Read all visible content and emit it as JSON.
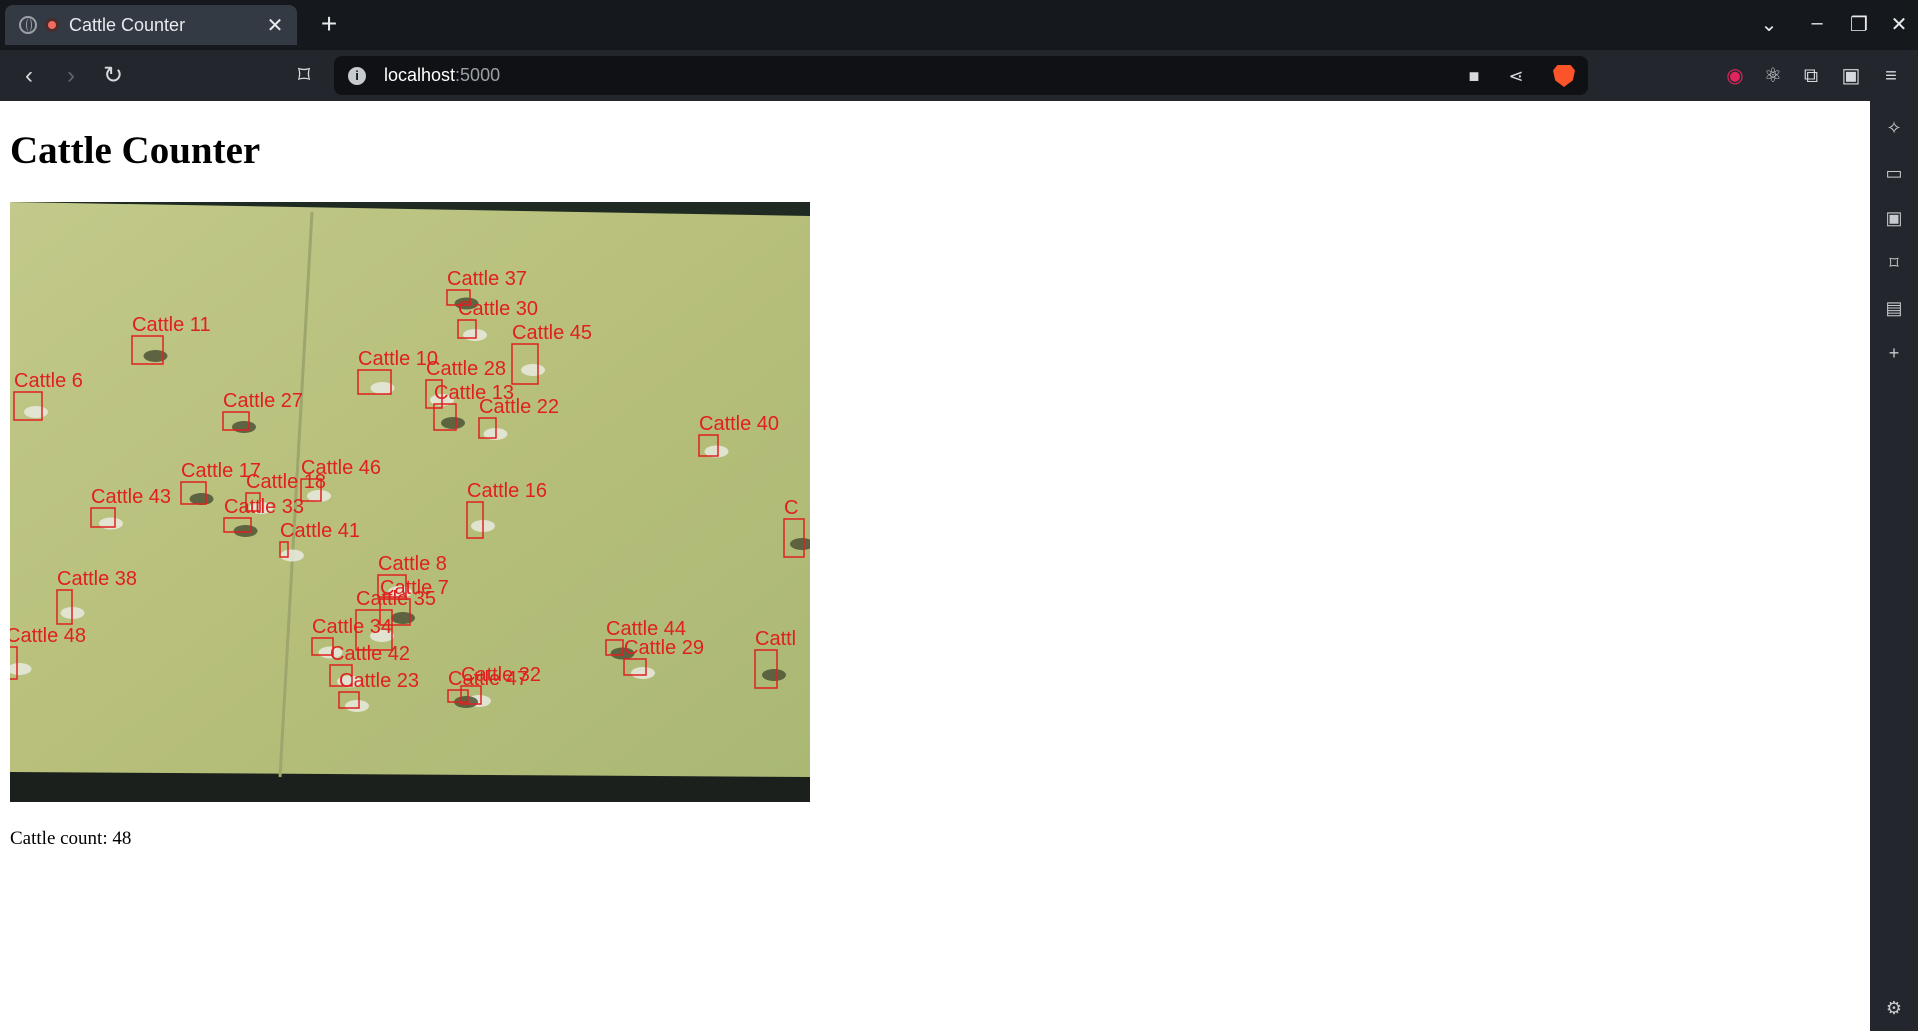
{
  "browser": {
    "tab_title": "Cattle Counter",
    "url_host": "localhost",
    "url_port": ":5000"
  },
  "page": {
    "heading": "Cattle Counter",
    "count_label": "Cattle count: ",
    "count_value": "48"
  },
  "detections": [
    {
      "label": "Cattle 37"
    },
    {
      "label": "Cattle 30"
    },
    {
      "label": "Cattle 45"
    },
    {
      "label": "Cattle 11"
    },
    {
      "label": "Cattle 10"
    },
    {
      "label": "Cattle 28"
    },
    {
      "label": "Cattle 13"
    },
    {
      "label": "Cattle 22"
    },
    {
      "label": "Cattle 6"
    },
    {
      "label": "Cattle 27"
    },
    {
      "label": "Cattle 40"
    },
    {
      "label": "Cattle 46"
    },
    {
      "label": "Cattle 17"
    },
    {
      "label": "Cattle 18"
    },
    {
      "label": "Cattle 43"
    },
    {
      "label": "Cattle 33"
    },
    {
      "label": "Cattle 16"
    },
    {
      "label": "Cattle 41"
    },
    {
      "label": "C"
    },
    {
      "label": "Cattle 8"
    },
    {
      "label": "Cattle 38"
    },
    {
      "label": "Cattle 7"
    },
    {
      "label": "Cattle 35"
    },
    {
      "label": "Cattle 34"
    },
    {
      "label": "Cattle 44"
    },
    {
      "label": "Cattle 48"
    },
    {
      "label": "Cattle 29"
    },
    {
      "label": "Cattl"
    },
    {
      "label": "Cattle 42"
    },
    {
      "label": "Cattle 32"
    },
    {
      "label": "Cattle 47"
    },
    {
      "label": "Cattle 23"
    }
  ],
  "colors": {
    "box": "#e02020",
    "field": "#b9c384"
  }
}
